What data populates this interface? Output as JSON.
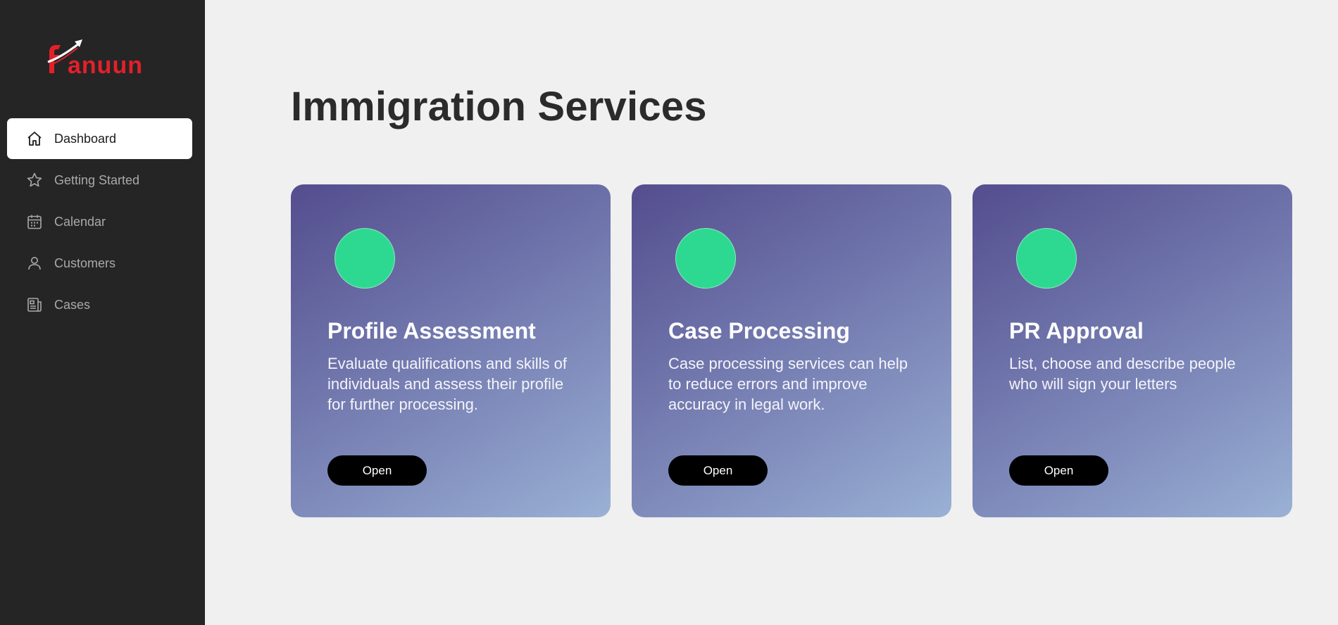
{
  "sidebar": {
    "logo_text": "anuun",
    "items": [
      {
        "label": "Dashboard",
        "icon": "home-icon",
        "active": true
      },
      {
        "label": "Getting Started",
        "icon": "star-icon",
        "active": false
      },
      {
        "label": "Calendar",
        "icon": "calendar-icon",
        "active": false
      },
      {
        "label": "Customers",
        "icon": "user-icon",
        "active": false
      },
      {
        "label": "Cases",
        "icon": "document-icon",
        "active": false
      }
    ]
  },
  "main": {
    "title": "Immigration Services",
    "cards": [
      {
        "title": "Profile Assessment",
        "description": "Evaluate qualifications and skills of individuals and assess their profile for further processing.",
        "button_label": "Open"
      },
      {
        "title": "Case Processing",
        "description": "Case processing services can help to reduce errors and improve accuracy in legal work.",
        "button_label": "Open"
      },
      {
        "title": "PR Approval",
        "description": "List, choose and describe people who will sign your letters",
        "button_label": "Open"
      }
    ]
  },
  "colors": {
    "sidebar_bg": "#252525",
    "page_bg": "#eff0ef",
    "accent_red": "#e3202a",
    "circle_green": "#2dd991",
    "card_gradient_start": "#544d8e",
    "card_gradient_end": "#9ab1d4"
  }
}
